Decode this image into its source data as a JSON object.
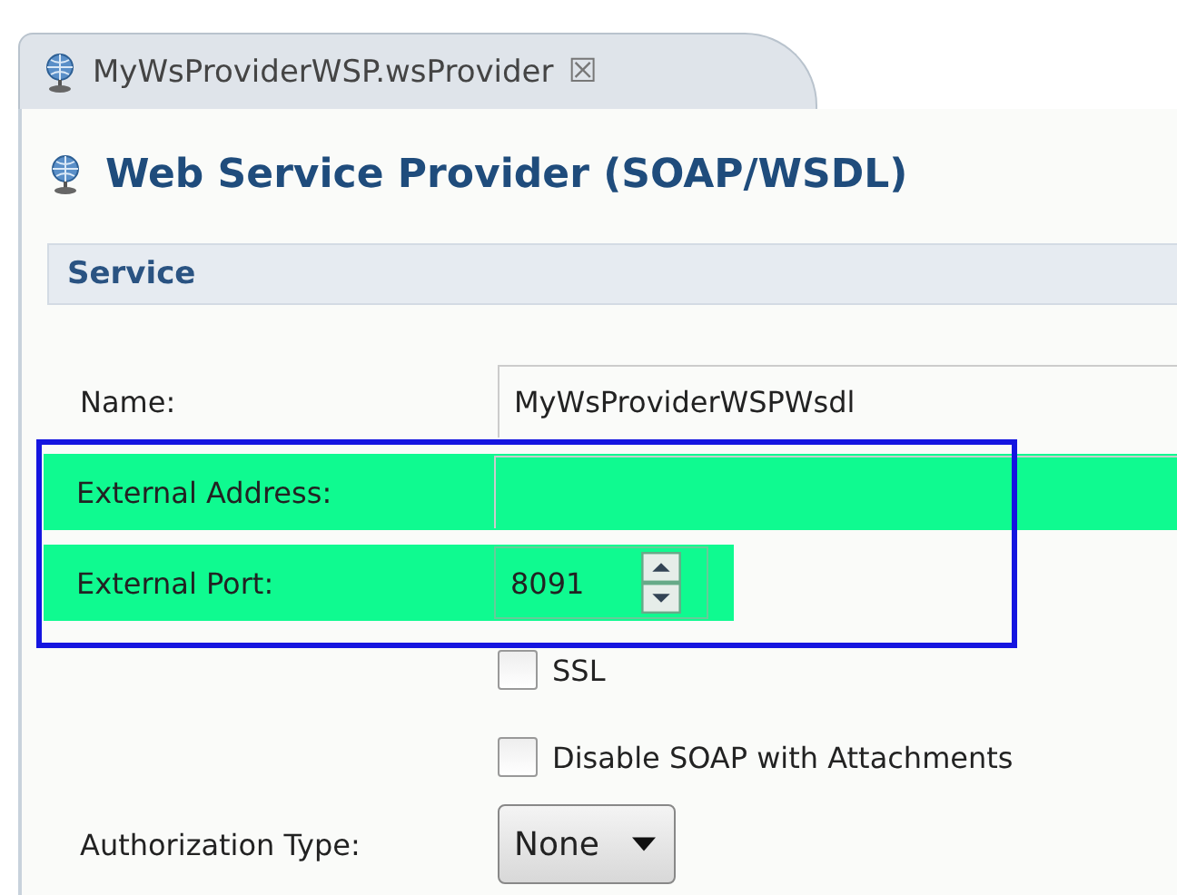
{
  "tab": {
    "label": "MyWsProviderWSP.wsProvider",
    "close": "☒",
    "selected": true
  },
  "title": "Web Service Provider (SOAP/WSDL)",
  "section": {
    "title": "Service"
  },
  "fields": [
    {
      "kind": "text",
      "label": "Name:",
      "value": "MyWsProviderWSPWsdl",
      "highlighted": false
    },
    {
      "kind": "text",
      "label": "External Address:",
      "highlighted": true
    },
    {
      "kind": "spinner",
      "label": "External Port:",
      "value": "8091",
      "highlighted": true
    },
    {
      "kind": "checkbox",
      "label": "SSL",
      "checked": false
    },
    {
      "kind": "checkbox",
      "label": "Disable SOAP with Attachments",
      "checked": false
    },
    {
      "kind": "dropdown",
      "label": "Authorization Type:",
      "value": "None"
    }
  ]
}
